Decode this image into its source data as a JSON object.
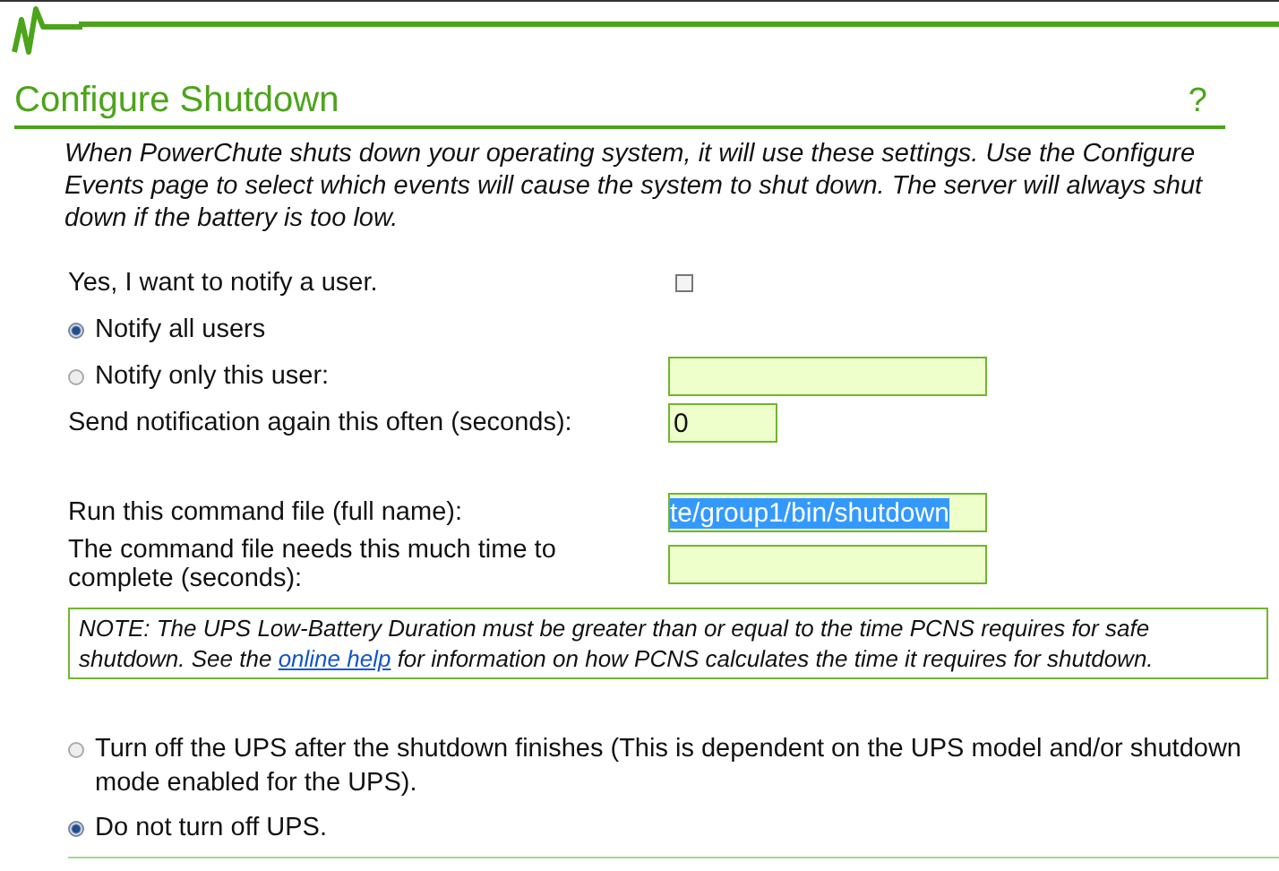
{
  "header": {
    "title": "Configure Shutdown",
    "help": "?"
  },
  "description": "When PowerChute shuts down your operating system, it will use these settings. Use the Configure Events page to select which events will cause the system to shut down. The server will always shut down if the battery is too low.",
  "notify_checkbox": {
    "label": "Yes, I want to notify a user.",
    "checked": false
  },
  "notify_options": [
    {
      "label": "Notify all users",
      "selected": true,
      "kind": "radio"
    },
    {
      "label": "Notify only this user:",
      "selected": false,
      "kind": "radio_field"
    }
  ],
  "repeat_field": {
    "label": "Send notification again this often (seconds):",
    "value": "0"
  },
  "command_field": {
    "label": "Run this command file (full name):",
    "value": "te/group1/bin/shutdown",
    "selected": true
  },
  "duration_field": {
    "label": "The command file needs this much time to complete (seconds):"
  },
  "note": {
    "before": "NOTE: The UPS Low-Battery Duration must be greater than or equal to the time PCNS requires for safe shutdown. See the",
    "link": "online help",
    "after": "for information on how PCNS calculates the time it requires for shutdown."
  },
  "ups_options": [
    {
      "label": "Turn off the UPS after the shutdown finishes (This is dependent on the UPS model and/or shutdown mode enabled for the UPS).",
      "selected": false
    },
    {
      "label": "Do not turn off UPS.",
      "selected": true
    }
  ]
}
